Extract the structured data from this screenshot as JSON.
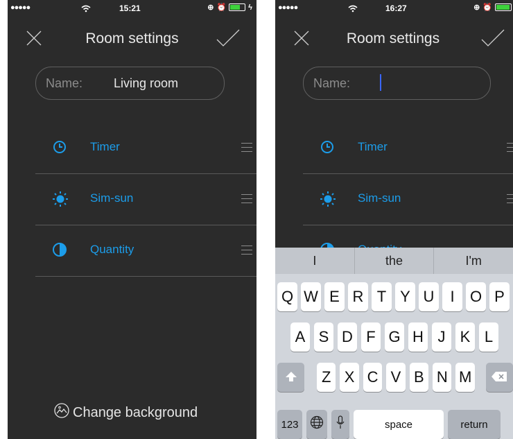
{
  "left": {
    "status": {
      "signal": "●●●●●",
      "time": "15:21"
    },
    "nav": {
      "title": "Room settings"
    },
    "name_field": {
      "label": "Name:",
      "value": "Living room"
    },
    "items": [
      {
        "label": "Timer",
        "icon": "clock-icon"
      },
      {
        "label": "Sim-sun",
        "icon": "sun-icon"
      },
      {
        "label": "Quantity",
        "icon": "half-circle-icon"
      }
    ],
    "change_background": "Change background"
  },
  "right": {
    "status": {
      "signal": "●●●●●",
      "time": "16:27"
    },
    "nav": {
      "title": "Room settings"
    },
    "name_field": {
      "label": "Name:",
      "value": ""
    },
    "items": [
      {
        "label": "Timer",
        "icon": "clock-icon"
      },
      {
        "label": "Sim-sun",
        "icon": "sun-icon"
      },
      {
        "label": "Quantity",
        "icon": "half-circle-icon"
      }
    ],
    "keyboard": {
      "predictions": [
        "I",
        "the",
        "I'm"
      ],
      "row1": [
        "Q",
        "W",
        "E",
        "R",
        "T",
        "Y",
        "U",
        "I",
        "O",
        "P"
      ],
      "row2": [
        "A",
        "S",
        "D",
        "F",
        "G",
        "H",
        "J",
        "K",
        "L"
      ],
      "row3": [
        "Z",
        "X",
        "C",
        "V",
        "B",
        "N",
        "M"
      ],
      "numbers": "123",
      "space": "space",
      "return": "return"
    }
  },
  "colors": {
    "background": "#2b2b2b",
    "accent": "#1c9dea",
    "caret": "#3a66ff",
    "battery": "#3ed23c"
  }
}
